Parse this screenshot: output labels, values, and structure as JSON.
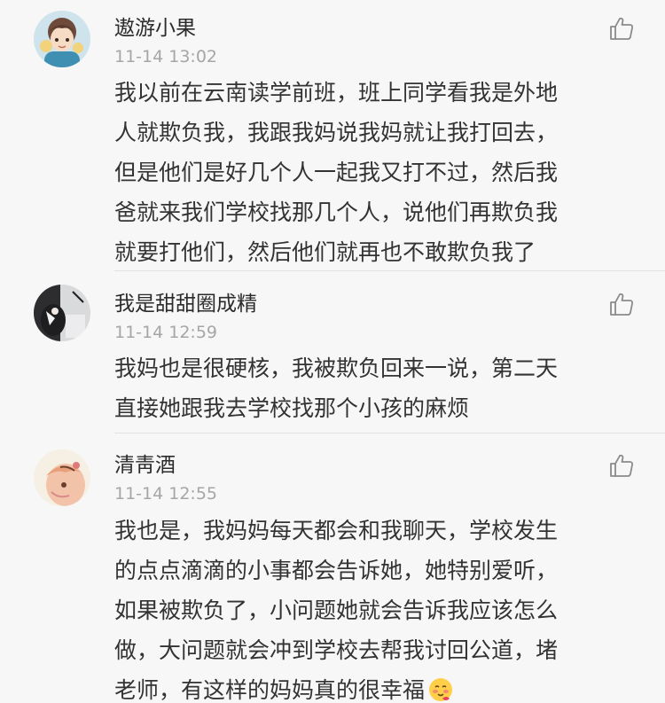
{
  "comments": [
    {
      "username": "遨游小果",
      "time": "11-14 13:02",
      "lines": [
        "我以前在云南读学前班，班上同学看我是外地",
        "人就欺负我，我跟我妈说我妈就让我打回去，",
        "但是他们是好几个人一起我又打不过，然后我",
        "爸就来我们学校找那几个人，说他们再欺负我",
        "就要打他们，然后他们就再也不敢欺负我了"
      ],
      "avatar_icon": "cartoon-boy-avatar"
    },
    {
      "username": "我是甜甜圈成精",
      "time": "11-14 12:59",
      "lines": [
        "我妈也是很硬核，我被欺负回来一说，第二天",
        "直接她跟我去学校找那个小孩的麻烦"
      ],
      "avatar_icon": "dark-photo-avatar"
    },
    {
      "username": "清靑酒",
      "time": "11-14 12:55",
      "lines": [
        "我也是，我妈妈每天都会和我聊天，学校发生",
        "的点点滴滴的小事都会告诉她，她特别爱听，",
        "如果被欺负了，小问题她就会告诉我应该怎么",
        "做，大问题就会冲到学校去帮我讨回公道，堵",
        "老师，有这样的妈妈真的很幸福"
      ],
      "trailing_emoji": "blushing-face-icon",
      "avatar_icon": "anime-girl-avatar"
    }
  ],
  "like_icon": "thumbs-up-icon",
  "colors": {
    "background": "#f7f7f7",
    "text": "#333333",
    "username": "#2b2b2b",
    "time": "#a6a6a6",
    "divider": "#e1e1e1",
    "icon": "#8a8a8a"
  }
}
